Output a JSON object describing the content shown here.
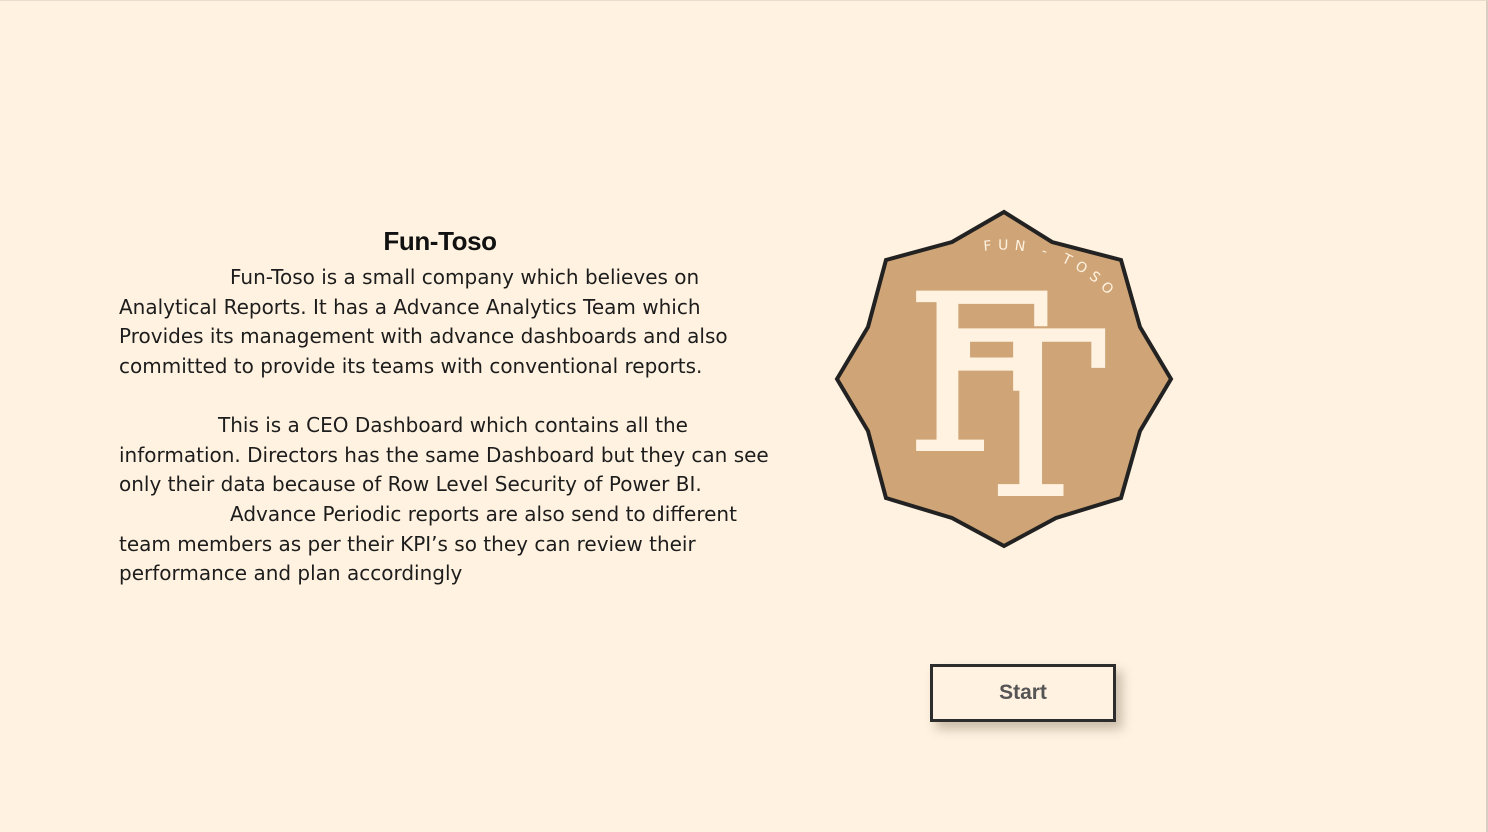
{
  "intro": {
    "title": "Fun-Toso",
    "paragraph_1": "Fun-Toso is a small company which believes on Analytical Reports. It has a Advance Analytics Team which Provides its management with advance dashboards and also committed to provide its teams with conventional reports.",
    "paragraph_2": "This is a CEO Dashboard which contains all the information. Directors has the same Dashboard but they can see only their data because of Row Level Security of Power BI.",
    "paragraph_3": "Advance Periodic reports are also send to different team members as per their KPI’s so they can review their performance and plan accordingly"
  },
  "logo": {
    "monogram_left": "F",
    "monogram_right": "T",
    "arc_text": "FUN - TOSO",
    "badge_color": "#cfa476",
    "outline_color": "#222222",
    "letter_color": "#fff2e0"
  },
  "actions": {
    "start_label": "Start"
  },
  "colors": {
    "background": "#fff2e0",
    "text": "#1d1d1d"
  }
}
